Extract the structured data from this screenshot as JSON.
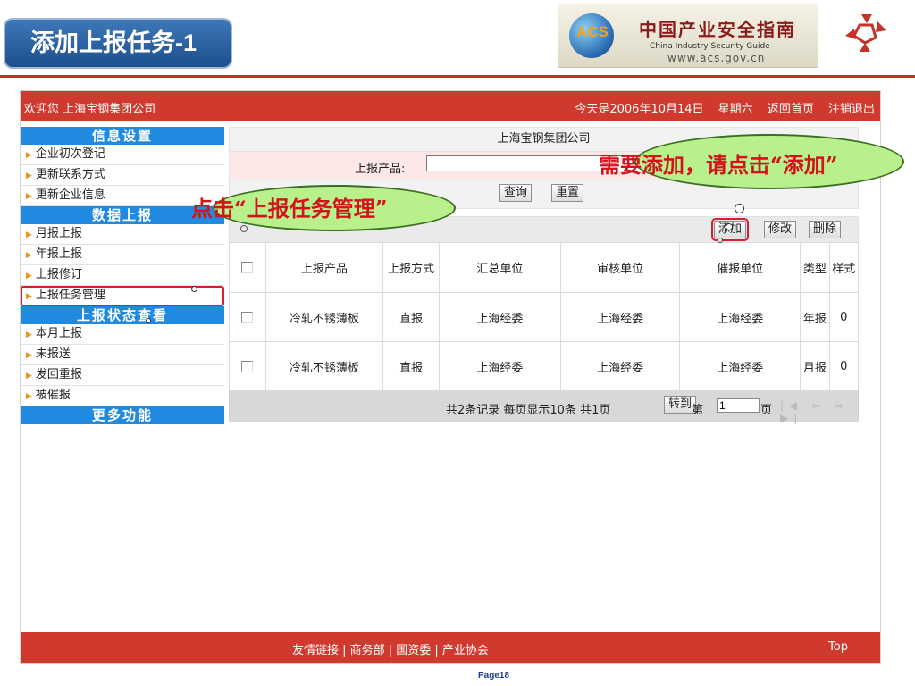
{
  "slide": {
    "title": "添加上报任务-1",
    "banner": {
      "badge": "ACS",
      "cn": "中国产业安全指南",
      "en": "China  Industry  Security  Guide",
      "url": "www.acs.gov.cn"
    },
    "page_label": "Page18"
  },
  "topbar": {
    "welcome": "欢迎您  上海宝钢集团公司",
    "date": "今天是2006年10月14日",
    "weekday": "星期六",
    "home": "返回首页",
    "logout": "注销退出"
  },
  "sidebar": {
    "sections": [
      {
        "title": "信息设置",
        "items": [
          "企业初次登记",
          "更新联系方式",
          "更新企业信息"
        ]
      },
      {
        "title": "数据上报",
        "items": [
          "月报上报",
          "年报上报",
          "上报修订",
          "上报任务管理"
        ]
      },
      {
        "title": "上报状态查看",
        "items": [
          "本月上报",
          "未报送",
          "发回重报",
          "被催报"
        ]
      },
      {
        "title": "更多功能",
        "items": []
      }
    ]
  },
  "search": {
    "company": "上海宝钢集团公司",
    "product_label": "上报产品:",
    "product_value": "",
    "query_label": "查询",
    "reset_label": "重置"
  },
  "toolbar": {
    "add_label": "添加",
    "edit_label": "修改",
    "delete_label": "删除"
  },
  "table": {
    "columns": [
      "上报产品",
      "上报方式",
      "汇总单位",
      "审核单位",
      "催报单位",
      "类型",
      "样式"
    ],
    "rows": [
      [
        "冷轧不锈薄板",
        "直报",
        "上海经委",
        "上海经委",
        "上海经委",
        "年报",
        "0"
      ],
      [
        "冷轧不锈薄板",
        "直报",
        "上海经委",
        "上海经委",
        "上海经委",
        "月报",
        "0"
      ]
    ]
  },
  "pager": {
    "summary": "共2条记录  每页显示10条  共1页",
    "goto_label": "转到",
    "page_prefix": "第",
    "page_value": "1",
    "page_suffix": "页"
  },
  "footer": {
    "links": "友情链接 | 商务部 | 国资委 | 产业协会",
    "top": "Top"
  },
  "callouts": {
    "add_hint": "需要添加，请点击“添加”",
    "task_hint": "点击“上报任务管理”"
  },
  "colors": {
    "accent_red": "#d03a2e",
    "section_blue": "#1f8ae0",
    "title_blue": "#2a63a6",
    "callout_green": "#b8f08c"
  }
}
